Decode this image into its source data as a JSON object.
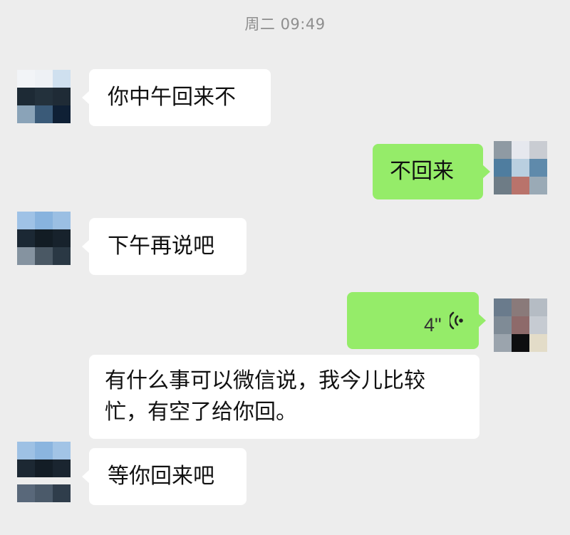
{
  "timestamp": "周二 09:49",
  "messages": [
    {
      "side": "left",
      "text": "你中午回来不"
    },
    {
      "side": "right",
      "text": "不回来"
    },
    {
      "side": "left",
      "text": "下午再说吧"
    },
    {
      "side": "right",
      "type": "voice",
      "duration": "4\"",
      "icon": "voice-wave-icon"
    },
    {
      "side": "left",
      "line1": "有什么事可以微信说，我今儿比较",
      "line2": "忙，有空了给你回。"
    },
    {
      "side": "left",
      "text": "等你回来吧"
    }
  ],
  "colors": {
    "background": "#ededed",
    "incoming_bubble": "#ffffff",
    "outgoing_bubble": "#95ec69",
    "timestamp_text": "#8e8e8e"
  }
}
